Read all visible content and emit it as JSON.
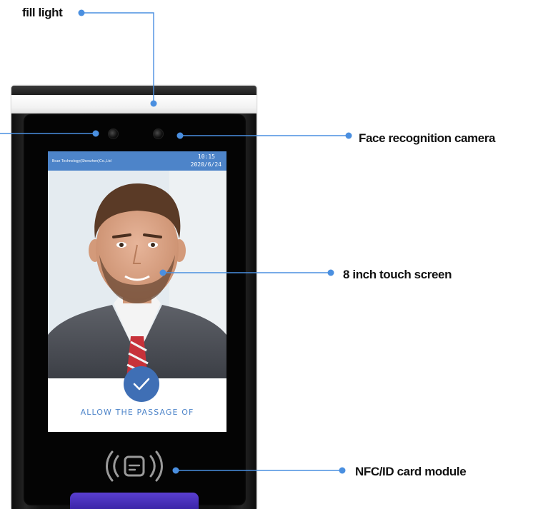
{
  "callouts": {
    "fill_light": "fill light",
    "face_camera": "Face recognition camera",
    "touch_screen": "8 inch touch screen",
    "nfc_module": "NFC/ID card module"
  },
  "screen": {
    "company": "Bozz Technology(Shenzhen)Co.,Ltd",
    "time": "10:15",
    "date": "2020/6/24",
    "status": "ALLOW THE PASSAGE OF"
  },
  "colors": {
    "callout_line": "#4a8fe0",
    "screen_header": "#4d84c9",
    "check_circle": "#3f6fb5",
    "bottom_led": "#4a31bf"
  },
  "icons": [
    "check-icon",
    "nfc-card-icon",
    "camera-icon"
  ]
}
